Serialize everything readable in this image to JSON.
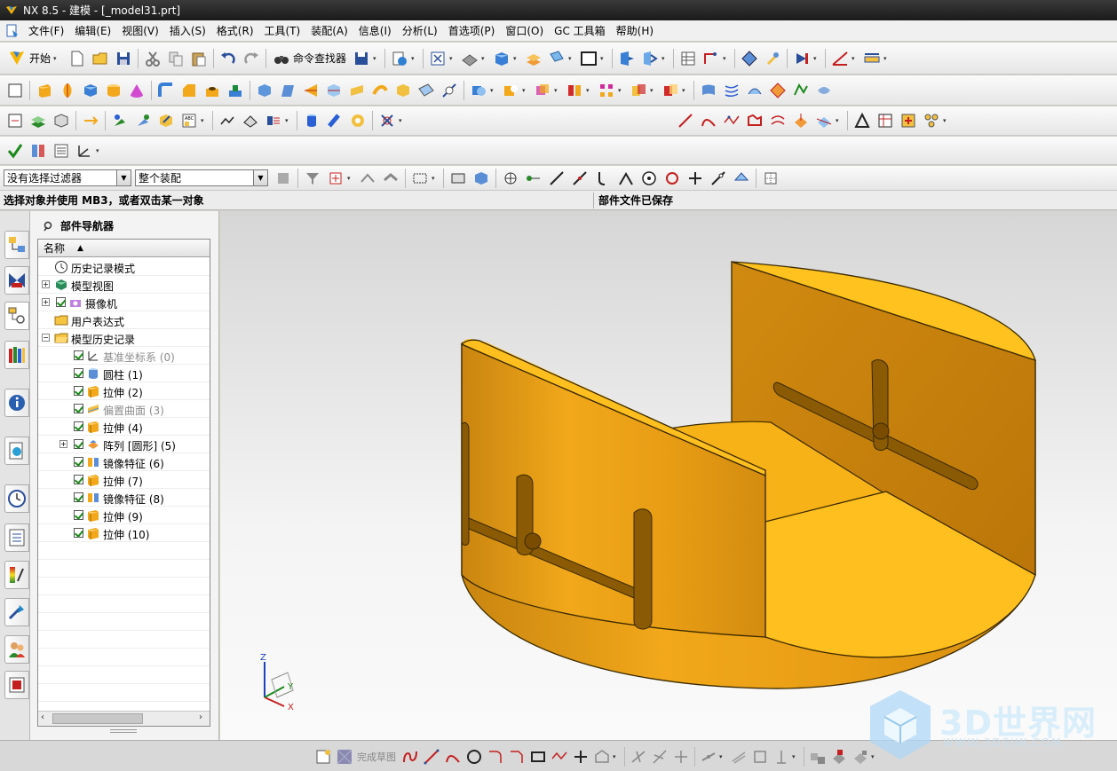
{
  "window": {
    "title": "NX 8.5 - 建模 - [_model31.prt]"
  },
  "menu": {
    "items": [
      "文件(F)",
      "编辑(E)",
      "视图(V)",
      "插入(S)",
      "格式(R)",
      "工具(T)",
      "装配(A)",
      "信息(I)",
      "分析(L)",
      "首选项(P)",
      "窗口(O)",
      "GC 工具箱",
      "帮助(H)"
    ]
  },
  "toolbar": {
    "start_label": "开始",
    "command_finder_label": "命令查找器"
  },
  "filter": {
    "selection_filter": "没有选择过滤器",
    "scope": "整个装配"
  },
  "status": {
    "prompt": "选择对象并使用 MB3，或者双击某一对象",
    "message": "部件文件已保存"
  },
  "navigator": {
    "title": "部件导航器",
    "column_header": "名称",
    "rows": [
      {
        "label": "历史记录模式",
        "icon": "clock-icon",
        "level": 0,
        "expander": "",
        "checked": false,
        "dim": false
      },
      {
        "label": "模型视图",
        "icon": "model-views-icon",
        "level": 0,
        "expander": "+",
        "checked": false,
        "dim": false
      },
      {
        "label": "摄像机",
        "icon": "camera-icon",
        "level": 0,
        "expander": "+",
        "checked": true,
        "dim": false
      },
      {
        "label": "用户表达式",
        "icon": "folder-icon",
        "level": 0,
        "expander": "",
        "checked": false,
        "dim": false
      },
      {
        "label": "模型历史记录",
        "icon": "folder-open-icon",
        "level": 0,
        "expander": "-",
        "checked": false,
        "dim": false
      },
      {
        "label": "基准坐标系 (0)",
        "icon": "datum-csys-icon",
        "level": 1,
        "expander": "",
        "checked": true,
        "dim": true
      },
      {
        "label": "圆柱 (1)",
        "icon": "cylinder-icon",
        "level": 1,
        "expander": "",
        "checked": true,
        "dim": false
      },
      {
        "label": "拉伸 (2)",
        "icon": "extrude-icon",
        "level": 1,
        "expander": "",
        "checked": true,
        "dim": false
      },
      {
        "label": "偏置曲面 (3)",
        "icon": "offset-surface-icon",
        "level": 1,
        "expander": "",
        "checked": true,
        "dim": true
      },
      {
        "label": "拉伸 (4)",
        "icon": "extrude-icon",
        "level": 1,
        "expander": "",
        "checked": true,
        "dim": false
      },
      {
        "label": "阵列 [圆形] (5)",
        "icon": "pattern-icon",
        "level": 1,
        "expander": "+",
        "checked": true,
        "dim": false
      },
      {
        "label": "镜像特征 (6)",
        "icon": "mirror-feature-icon",
        "level": 1,
        "expander": "",
        "checked": true,
        "dim": false
      },
      {
        "label": "拉伸 (7)",
        "icon": "extrude-icon",
        "level": 1,
        "expander": "",
        "checked": true,
        "dim": false
      },
      {
        "label": "镜像特征 (8)",
        "icon": "mirror-feature-icon",
        "level": 1,
        "expander": "",
        "checked": true,
        "dim": false
      },
      {
        "label": "拉伸 (9)",
        "icon": "extrude-icon",
        "level": 1,
        "expander": "",
        "checked": true,
        "dim": false
      },
      {
        "label": "拉伸 (10)",
        "icon": "extrude-icon",
        "level": 1,
        "expander": "",
        "checked": true,
        "dim": false
      }
    ]
  },
  "triad": {
    "x_label": "X",
    "y_label": "Y",
    "z_label": "Z"
  },
  "sketch_bar": {
    "finish_label": "完成草图"
  },
  "watermark": {
    "brand": "3D世界网",
    "url": "WWW.3DSJW.COM"
  },
  "colors": {
    "model_face_light": "#ffbf1e",
    "model_face_mid": "#f2a81a",
    "model_face_dark": "#c98510",
    "viewport_top": "#d6d6d6",
    "titlebar": "#1f1f1f"
  }
}
